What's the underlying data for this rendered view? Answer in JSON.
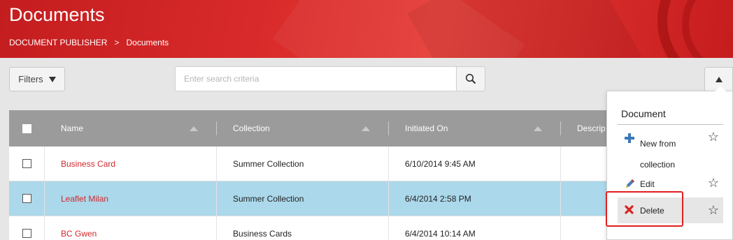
{
  "header": {
    "title": "Documents",
    "breadcrumb": [
      "DOCUMENT PUBLISHER",
      "Documents"
    ],
    "breadcrumb_separator": ">"
  },
  "toolbar": {
    "filters_label": "Filters",
    "search_placeholder": "Enter search criteria"
  },
  "table": {
    "columns": [
      "Name",
      "Collection",
      "Initiated On",
      "Descrip"
    ],
    "rows": [
      {
        "name": "Business Card",
        "collection": "Summer Collection",
        "initiated": "6/10/2014 9:45 AM",
        "selected": false
      },
      {
        "name": "Leaflet Milan",
        "collection": "Summer Collection",
        "initiated": "6/4/2014 2:58 PM",
        "selected": true
      },
      {
        "name": "BC Gwen",
        "collection": "Business Cards",
        "initiated": "6/4/2014 10:14 AM",
        "selected": false
      }
    ]
  },
  "menu": {
    "title": "Document",
    "items": [
      {
        "label_line1": "New from",
        "label_line2": "collection",
        "icon": "plus-icon"
      },
      {
        "label": "Edit",
        "icon": "pencil-icon"
      },
      {
        "label": "Delete",
        "icon": "x-icon"
      }
    ]
  },
  "colors": {
    "header_red": "#d82a2a",
    "link_red": "#d0282b",
    "selected_row": "#abd8ea",
    "highlight": "#e02020"
  }
}
